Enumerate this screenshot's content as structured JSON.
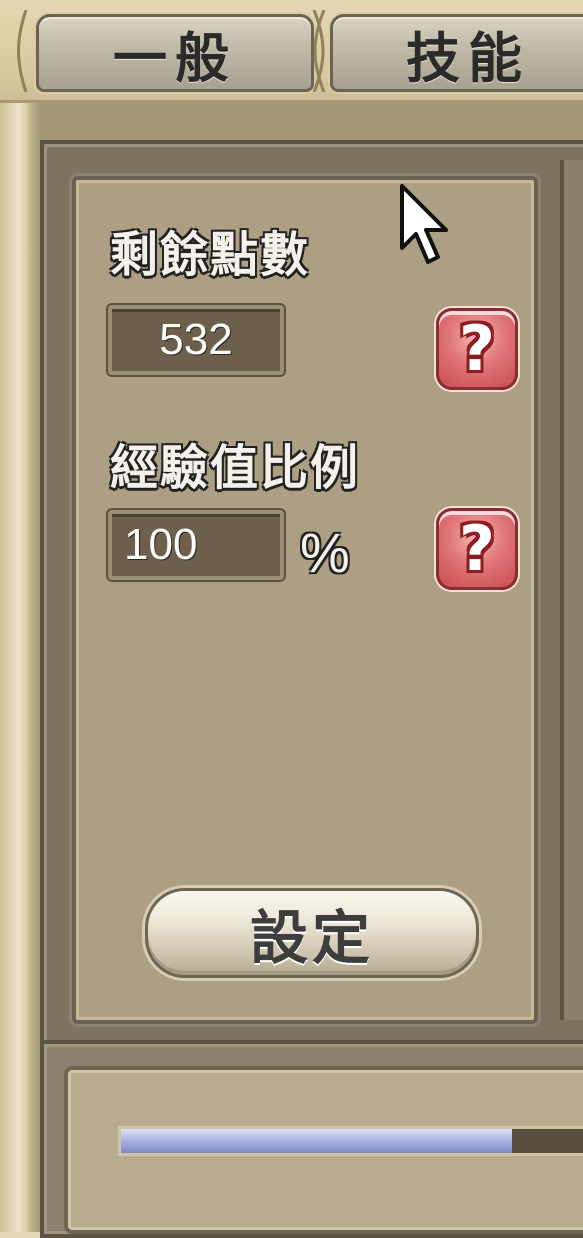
{
  "tabs": [
    {
      "label": "一般",
      "active": true
    },
    {
      "label": "技能",
      "active": false
    }
  ],
  "panel": {
    "remaining_points_label": "剩餘點數",
    "remaining_points_value": "532",
    "exp_ratio_label": "經驗值比例",
    "exp_ratio_value": "100",
    "exp_ratio_unit": "%",
    "help_glyph": "?",
    "set_button_label": "設定"
  },
  "progress": {
    "fraction": 0.82
  },
  "colors": {
    "help_button": "#e0777a",
    "progress_fill": "#a7b2e0",
    "panel_bg": "#ac9f83"
  },
  "icons": [
    "help-icon",
    "mouse-cursor-icon"
  ]
}
